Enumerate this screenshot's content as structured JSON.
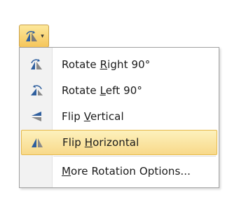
{
  "rotate_button": {
    "icon": "rotate-objects-icon",
    "dropdown_icon": "caret-down-icon"
  },
  "menu": {
    "items": [
      {
        "pre": "Rotate ",
        "key": "R",
        "post": "ight 90°",
        "icon": "rotate-right-icon"
      },
      {
        "pre": "Rotate ",
        "key": "L",
        "post": "eft 90°",
        "icon": "rotate-left-icon"
      },
      {
        "pre": "Flip ",
        "key": "V",
        "post": "ertical",
        "icon": "flip-vertical-icon"
      },
      {
        "pre": "Flip ",
        "key": "H",
        "post": "orizontal",
        "icon": "flip-horizontal-icon",
        "highlighted": true
      },
      {
        "pre": "",
        "key": "M",
        "post": "ore Rotation Options...",
        "icon": ""
      }
    ]
  },
  "colors": {
    "highlight": "#f8d98a",
    "highlight_border": "#e6b94a"
  }
}
